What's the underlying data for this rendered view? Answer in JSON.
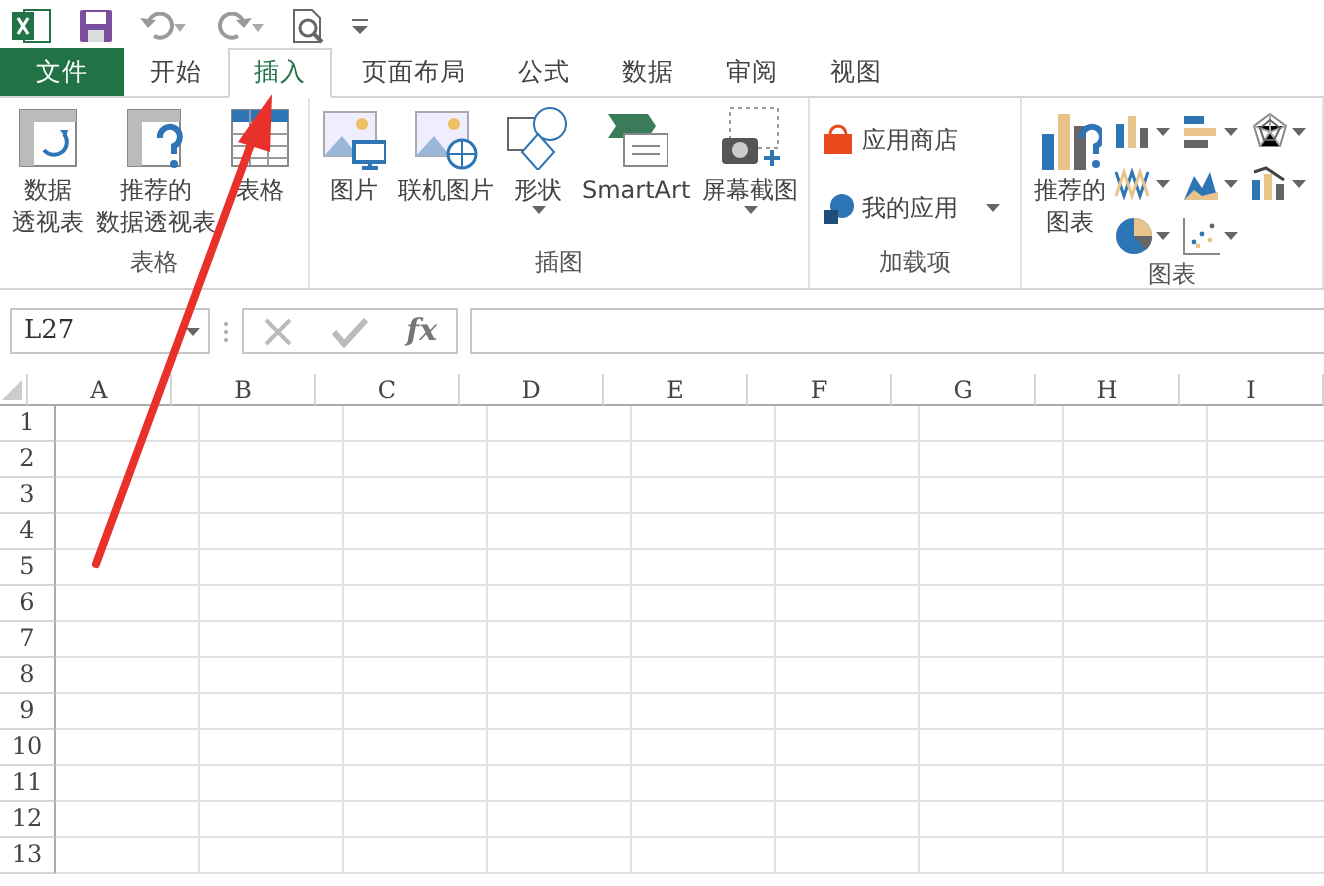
{
  "tabs": [
    {
      "label": "文件",
      "kind": "file",
      "selected": false
    },
    {
      "label": "开始",
      "kind": "tab",
      "selected": false
    },
    {
      "label": "插入",
      "kind": "tab",
      "selected": true
    },
    {
      "label": "页面布局",
      "kind": "tab",
      "selected": false
    },
    {
      "label": "公式",
      "kind": "tab",
      "selected": false
    },
    {
      "label": "数据",
      "kind": "tab",
      "selected": false
    },
    {
      "label": "审阅",
      "kind": "tab",
      "selected": false
    },
    {
      "label": "视图",
      "kind": "tab",
      "selected": false
    }
  ],
  "ribbon_groups": [
    {
      "label": "表格",
      "commands": [
        {
          "kind": "large",
          "label_lines": [
            "数据",
            "透视表"
          ],
          "dropdown": false
        },
        {
          "kind": "large",
          "label_lines": [
            "推荐的",
            "数据透视表"
          ],
          "dropdown": false
        },
        {
          "kind": "large",
          "label_lines": [
            "表格"
          ],
          "dropdown": false
        }
      ]
    },
    {
      "label": "插图",
      "commands": [
        {
          "kind": "large",
          "label_lines": [
            "图片"
          ],
          "dropdown": false
        },
        {
          "kind": "large",
          "label_lines": [
            "联机图片"
          ],
          "dropdown": false
        },
        {
          "kind": "large",
          "label_lines": [
            "形状"
          ],
          "dropdown": true
        },
        {
          "kind": "large",
          "label_lines": [
            "SmartArt"
          ],
          "dropdown": false
        },
        {
          "kind": "large",
          "label_lines": [
            "屏幕截图"
          ],
          "dropdown": true
        }
      ]
    },
    {
      "label": "加载项",
      "commands": [
        {
          "kind": "small",
          "label_lines": [
            "应用商店"
          ],
          "dropdown": false
        },
        {
          "kind": "small",
          "label_lines": [
            "我的应用"
          ],
          "dropdown": true
        }
      ]
    },
    {
      "label": "图表",
      "commands": [
        {
          "kind": "large",
          "label_lines": [
            "推荐的",
            "图表"
          ],
          "dropdown": false
        },
        {
          "kind": "gallery",
          "dropdown": true
        },
        {
          "kind": "gallery",
          "dropdown": true
        },
        {
          "kind": "gallery",
          "dropdown": true
        },
        {
          "kind": "gallery",
          "dropdown": true
        },
        {
          "kind": "gallery",
          "dropdown": true
        },
        {
          "kind": "gallery",
          "dropdown": true
        },
        {
          "kind": "gallery",
          "dropdown": true
        },
        {
          "kind": "gallery",
          "dropdown": true
        }
      ]
    }
  ],
  "formula_bar": {
    "name_box": "L27",
    "fx": "fx"
  },
  "columns": [
    "A",
    "B",
    "C",
    "D",
    "E",
    "F",
    "G",
    "H",
    "I"
  ],
  "rows": [
    "1",
    "2",
    "3",
    "4",
    "5",
    "6",
    "7",
    "8",
    "9",
    "10",
    "11",
    "12",
    "13"
  ]
}
